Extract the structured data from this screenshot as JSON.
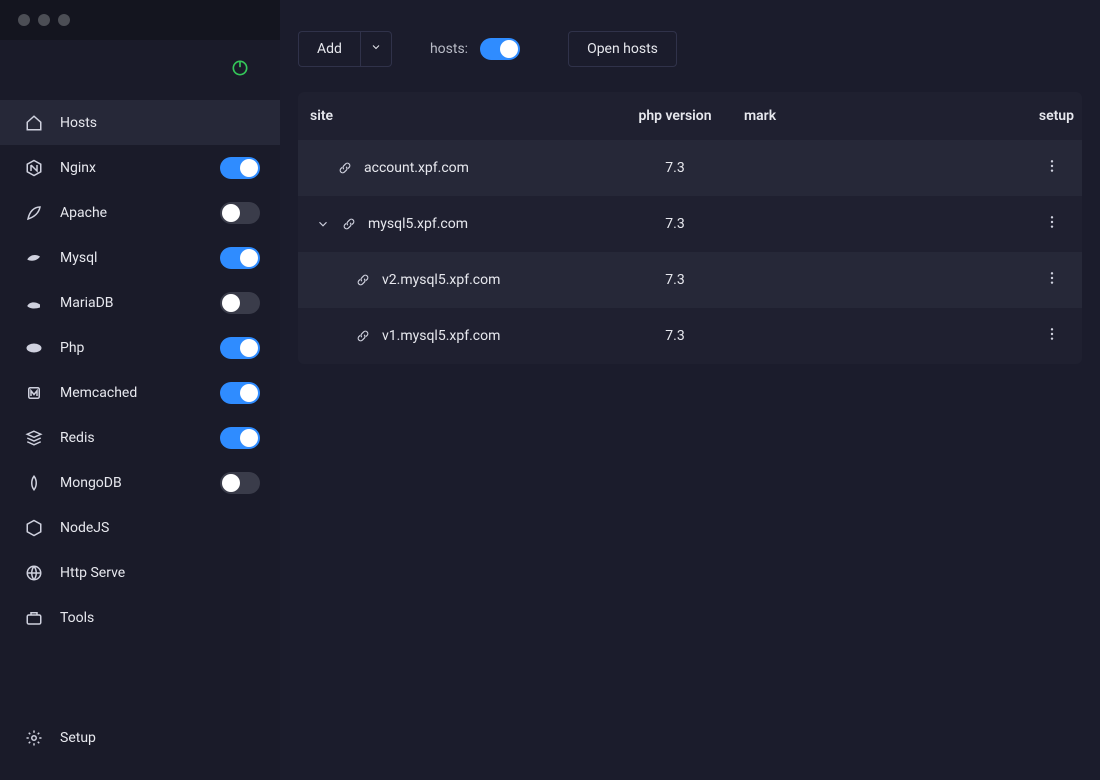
{
  "toolbar": {
    "add_label": "Add",
    "hosts_label": "hosts:",
    "hosts_toggle_on": true,
    "open_hosts_label": "Open hosts"
  },
  "sidebar": {
    "power_on": true,
    "items": [
      {
        "id": "hosts",
        "label": "Hosts",
        "icon": "home-icon",
        "active": true,
        "toggle": null
      },
      {
        "id": "nginx",
        "label": "Nginx",
        "icon": "nginx-icon",
        "active": false,
        "toggle": true
      },
      {
        "id": "apache",
        "label": "Apache",
        "icon": "feather-icon",
        "active": false,
        "toggle": false
      },
      {
        "id": "mysql",
        "label": "Mysql",
        "icon": "dolphin-icon",
        "active": false,
        "toggle": true
      },
      {
        "id": "mariadb",
        "label": "MariaDB",
        "icon": "seal-icon",
        "active": false,
        "toggle": false
      },
      {
        "id": "php",
        "label": "Php",
        "icon": "php-icon",
        "active": false,
        "toggle": true
      },
      {
        "id": "memcached",
        "label": "Memcached",
        "icon": "memcached-icon",
        "active": false,
        "toggle": true
      },
      {
        "id": "redis",
        "label": "Redis",
        "icon": "stack-icon",
        "active": false,
        "toggle": true
      },
      {
        "id": "mongodb",
        "label": "MongoDB",
        "icon": "leaf-icon",
        "active": false,
        "toggle": false
      },
      {
        "id": "nodejs",
        "label": "NodeJS",
        "icon": "hex-icon",
        "active": false,
        "toggle": null
      },
      {
        "id": "httpserve",
        "label": "Http Serve",
        "icon": "globe-icon",
        "active": false,
        "toggle": null
      },
      {
        "id": "tools",
        "label": "Tools",
        "icon": "toolbox-icon",
        "active": false,
        "toggle": null
      }
    ],
    "footer": {
      "label": "Setup",
      "icon": "gear-icon"
    }
  },
  "table": {
    "columns": {
      "site": "site",
      "php": "php version",
      "mark": "mark",
      "setup": "setup"
    },
    "rows": [
      {
        "site": "account.xpf.com",
        "php": "7.3",
        "mark": "",
        "depth": 1,
        "expandable": false,
        "shade": 0
      },
      {
        "site": "mysql5.xpf.com",
        "php": "7.3",
        "mark": "",
        "depth": 1,
        "expandable": true,
        "shade": 1
      },
      {
        "site": "v2.mysql5.xpf.com",
        "php": "7.3",
        "mark": "",
        "depth": 2,
        "expandable": false,
        "shade": 0
      },
      {
        "site": "v1.mysql5.xpf.com",
        "php": "7.3",
        "mark": "",
        "depth": 2,
        "expandable": false,
        "shade": 1
      }
    ]
  }
}
